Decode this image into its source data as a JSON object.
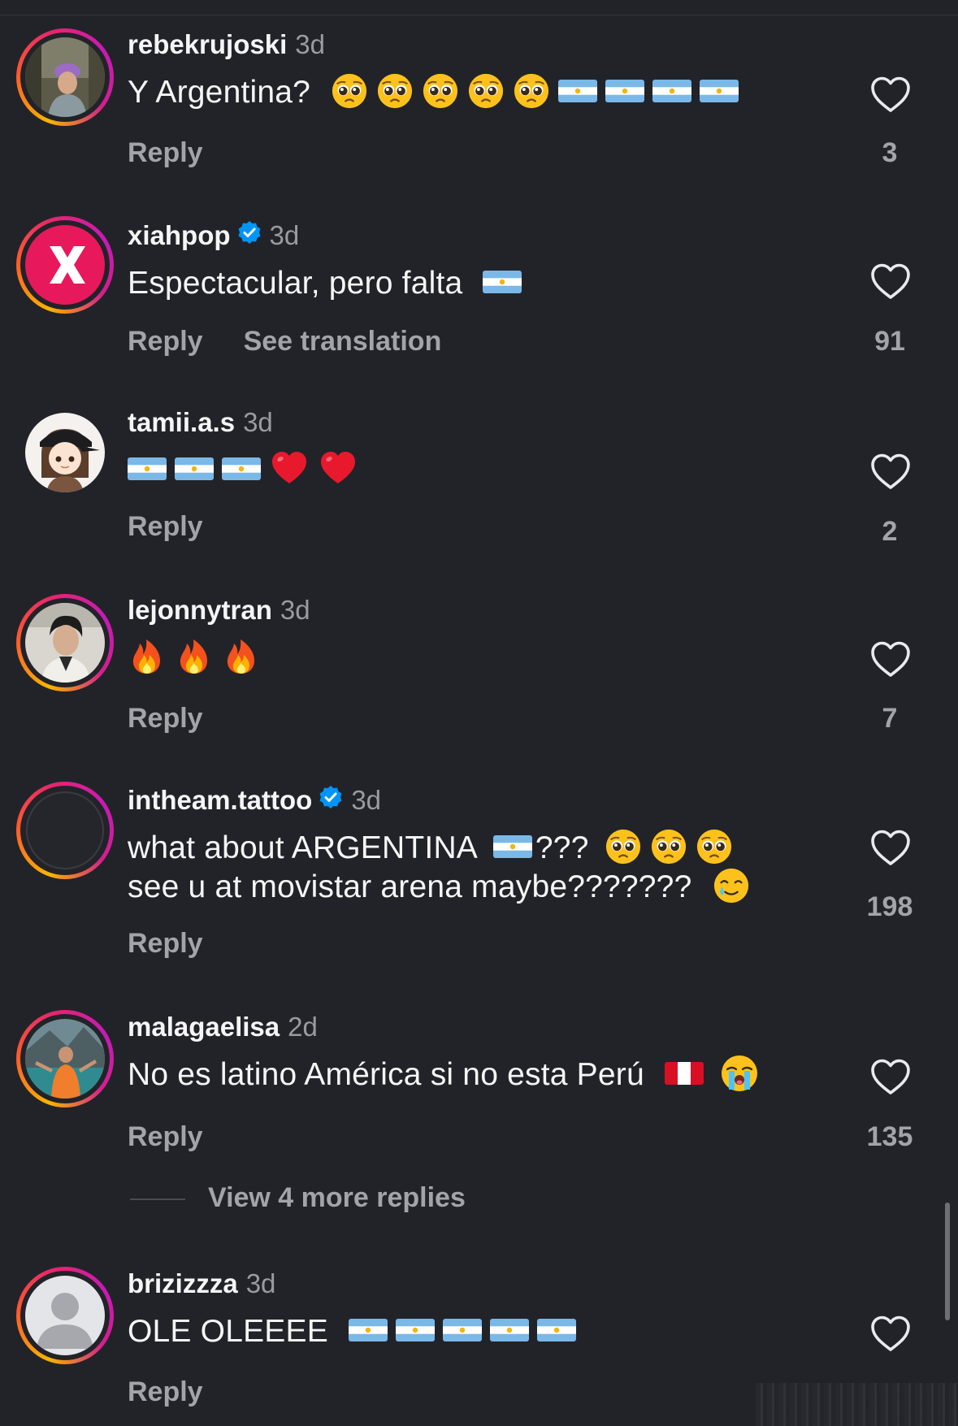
{
  "comments": [
    {
      "username": "rebekrujoski",
      "verified": false,
      "time": "3d",
      "text": "Y Argentina?",
      "emojis_after": "🥺🥺🥺🥺🥺🇦🇷🇦🇷🇦🇷🇦🇷",
      "reply_label": "Reply",
      "likes": "3",
      "avatar": "photo-woman-purple-cap"
    },
    {
      "username": "xiahpop",
      "verified": true,
      "time": "3d",
      "text": "Espectacular, pero falta",
      "emojis_after": "🇦🇷",
      "reply_label": "Reply",
      "translate_label": "See translation",
      "likes": "91",
      "avatar": "logo-pink-x"
    },
    {
      "username": "tamii.a.s",
      "verified": false,
      "time": "3d",
      "text": "",
      "emojis_after": "🇦🇷🇦🇷🇦🇷❤️❤️",
      "reply_label": "Reply",
      "likes": "2",
      "avatar": "anime-girl-cap"
    },
    {
      "username": "lejonnytran",
      "verified": false,
      "time": "3d",
      "text": "",
      "emojis_after": "🔥🔥🔥",
      "reply_label": "Reply",
      "likes": "7",
      "avatar": "photo-man-dark-hair"
    },
    {
      "username": "intheam.tattoo",
      "verified": true,
      "time": "3d",
      "text_line1": "what about ARGENTINA",
      "text_line1_mid": "???",
      "text_line2": "see u at movistar arena maybe???????",
      "emojis_line1": "🇦🇷 🥺🥺🥺",
      "emojis_line2": "🥲",
      "reply_label": "Reply",
      "likes": "198",
      "avatar": "dark-circle"
    },
    {
      "username": "malagaelisa",
      "verified": false,
      "time": "2d",
      "text": "No es latino América si no esta Perú",
      "emojis_after": "🇵🇪 😭",
      "reply_label": "Reply",
      "likes": "135",
      "avatar": "photo-person-mountains"
    },
    {
      "username": "brizizzza",
      "verified": false,
      "time": "3d",
      "text": "OLE OLEEEE",
      "emojis_after": "🇦🇷🇦🇷🇦🇷🇦🇷🇦🇷",
      "reply_label": "Reply",
      "avatar": "default-person"
    }
  ],
  "view_more_replies": "View 4 more replies",
  "colors": {
    "background": "#222329",
    "secondary_text": "#a3a3aa",
    "verified_blue": "#0095f6",
    "story_ring": [
      "#f7b500",
      "#fd5c2b",
      "#e6266c",
      "#c71ab6"
    ]
  }
}
